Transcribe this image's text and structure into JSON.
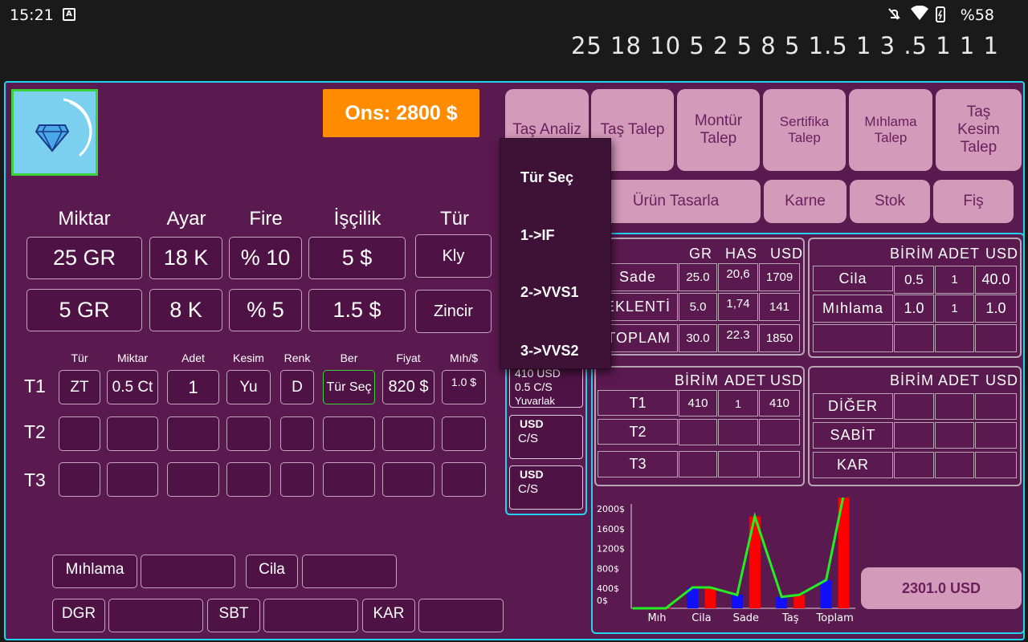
{
  "status": {
    "time": "15:21",
    "battery": "%58",
    "a_icon": "A"
  },
  "number_row": "25 18 10 5 2 5 8 5 1.5 1 3 .5 1 1 1",
  "ons": "Ons: 2800 $",
  "headers": {
    "miktar": "Miktar",
    "ayar": "Ayar",
    "fire": "Fire",
    "iscilik": "İşçilik",
    "tur": "Tür"
  },
  "row1": {
    "miktar": "25 GR",
    "ayar": "18 K",
    "fire": "% 10",
    "iscilik": "5 $",
    "tur": "Kly"
  },
  "row2": {
    "miktar": "5 GR",
    "ayar": "8 K",
    "fire": "% 5",
    "iscilik": "1.5 $",
    "tur": "Zincir"
  },
  "stone_headers": [
    "Tür",
    "Miktar",
    "Adet",
    "Kesim",
    "Renk",
    "Ber",
    "Fiyat",
    "Mıh/$"
  ],
  "stone_rows": [
    {
      "label": "T1",
      "tur": "ZT",
      "miktar": "0.5 Ct",
      "adet": "1",
      "kesim": "Yu",
      "renk": "D",
      "ber": "Tür Seç",
      "fiyat": "820 $",
      "mih": "1.0 $"
    },
    {
      "label": "T2"
    },
    {
      "label": "T3"
    }
  ],
  "bottom": {
    "mihlama": "Mıhlama",
    "cila": "Cila",
    "dgr": "DGR",
    "sbt": "SBT",
    "kar": "KAR"
  },
  "top_buttons": [
    "Taş Analiz",
    "Taş Talep",
    "Montür Talep",
    "Sertifika Talep",
    "Mıhlama Talep",
    "Taş Kesim Talep"
  ],
  "second_buttons": {
    "urun": "Ürün Tasarla",
    "karne": "Karne",
    "stok": "Stok",
    "fis": "Fiş"
  },
  "dropdown": [
    "Tür Seç",
    "1->IF",
    "2->VVS1",
    "3->VVS2"
  ],
  "mid": {
    "t1": [
      "410 USD",
      "0.5 C/S",
      "Yuvarlak"
    ],
    "t2": [
      "USD",
      "C/S"
    ],
    "t3": [
      "USD",
      "C/S"
    ]
  },
  "table_main": {
    "headers": [
      "GR",
      "HAS",
      "USD"
    ],
    "rows": [
      {
        "label": "Sade",
        "gr": "25.0",
        "has": "20,6",
        "usd": "1709"
      },
      {
        "label": "EKLENTİ",
        "gr": "5.0",
        "has": "1,74",
        "usd": "141"
      },
      {
        "label": "TOPLAM",
        "gr": "30.0",
        "has": "22.3",
        "usd": "1850"
      }
    ]
  },
  "table_cila": {
    "headers": [
      "BİRİM",
      "ADET",
      "USD"
    ],
    "rows": [
      {
        "label": "Cila",
        "birim": "0.5",
        "adet": "1",
        "usd": "40.0"
      },
      {
        "label": "Mıhlama",
        "birim": "1.0",
        "adet": "1",
        "usd": "1.0"
      },
      {
        "label": "",
        "birim": "",
        "adet": "",
        "usd": ""
      }
    ]
  },
  "table_stone": {
    "headers": [
      "BİRİM",
      "ADET",
      "USD"
    ],
    "rows": [
      {
        "label": "T1",
        "birim": "410",
        "adet": "1",
        "usd": "410"
      },
      {
        "label": "T2",
        "birim": "",
        "adet": "",
        "usd": ""
      },
      {
        "label": "T3",
        "birim": "",
        "adet": "",
        "usd": ""
      }
    ]
  },
  "table_other": {
    "headers": [
      "BİRİM",
      "ADET",
      "USD"
    ],
    "rows": [
      {
        "label": "DİĞER"
      },
      {
        "label": "SABİT"
      },
      {
        "label": "KAR"
      }
    ]
  },
  "total": "2301.0 USD",
  "colors": {
    "bg": "#5b1a4f",
    "accent": "#22d3ee",
    "ons": "#ff8c00",
    "pink": "#d39ab9",
    "bar_blue": "#1010ff",
    "bar_red": "#ff0000",
    "line": "#22ee22"
  },
  "chart_data": {
    "type": "bar",
    "categories": [
      "Mıh",
      "Cila",
      "Sade",
      "Taş",
      "Toplam"
    ],
    "y_ticks": [
      "0$",
      "400$",
      "800$",
      "1200$",
      "1600$",
      "2000$"
    ],
    "ylim": [
      0,
      2100
    ],
    "bars": [
      {
        "x": 0,
        "series": "blue",
        "value": 1
      },
      {
        "x": 0.5,
        "series": "red",
        "value": 1
      },
      {
        "x": 1,
        "series": "blue",
        "value": 420
      },
      {
        "x": 1.5,
        "series": "red",
        "value": 420
      },
      {
        "x": 2,
        "series": "blue",
        "value": 270
      },
      {
        "x": 2.5,
        "series": "red",
        "value": 1850
      },
      {
        "x": 3,
        "series": "blue",
        "value": 230
      },
      {
        "x": 3.5,
        "series": "red",
        "value": 270
      },
      {
        "x": 4,
        "series": "blue",
        "value": 570
      },
      {
        "x": 4.5,
        "series": "red",
        "value": 2301
      }
    ],
    "line": [
      1,
      1,
      420,
      420,
      270,
      1850,
      230,
      270,
      570,
      2301
    ]
  }
}
